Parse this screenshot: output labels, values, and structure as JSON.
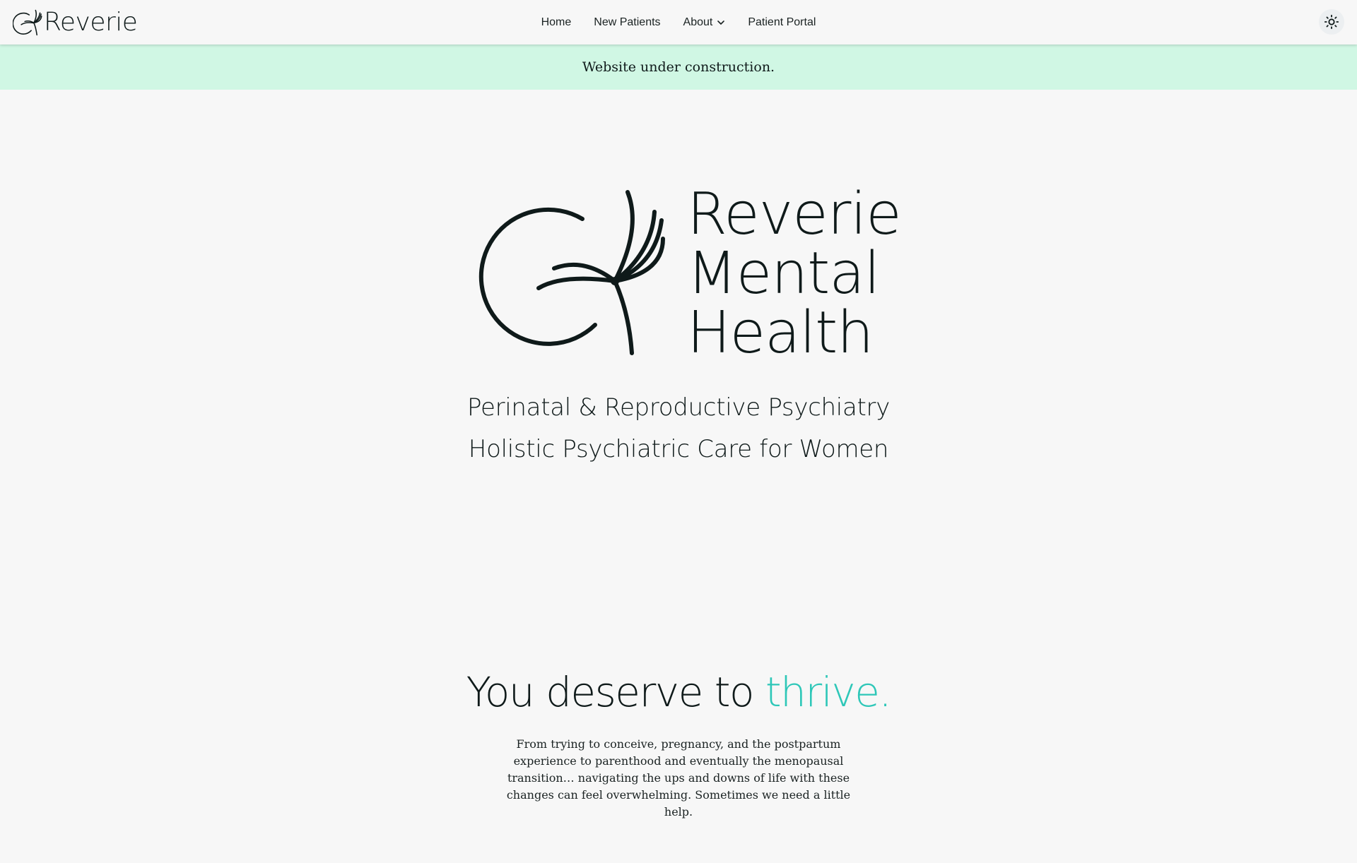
{
  "nav": {
    "brand": "Reverie",
    "links": [
      {
        "label": "Home"
      },
      {
        "label": "New Patients"
      },
      {
        "label": "About"
      },
      {
        "label": "Patient Portal"
      }
    ],
    "theme_toggle_icon": "sun-icon"
  },
  "banner": {
    "text": "Website under construction."
  },
  "hero": {
    "title_lines": [
      "Reverie",
      "Mental",
      "Health"
    ],
    "subtitles": [
      "Perinatal & Reproductive Psychiatry",
      "Holistic Psychiatric Care for Women"
    ]
  },
  "tagline": {
    "prefix": "You deserve to ",
    "accent": "thrive.",
    "accent_color": "#2ec7b8"
  },
  "intro": {
    "text": "From trying to conceive, pregnancy, and the postpartum experience to parenthood and eventually the menopausal transition… navigating the ups and downs of life with these changes can feel overwhelming. Sometimes we need a little help."
  },
  "colors": {
    "background": "#f7f7f7",
    "banner": "#d0f7e4",
    "text": "#0f1a1a"
  }
}
